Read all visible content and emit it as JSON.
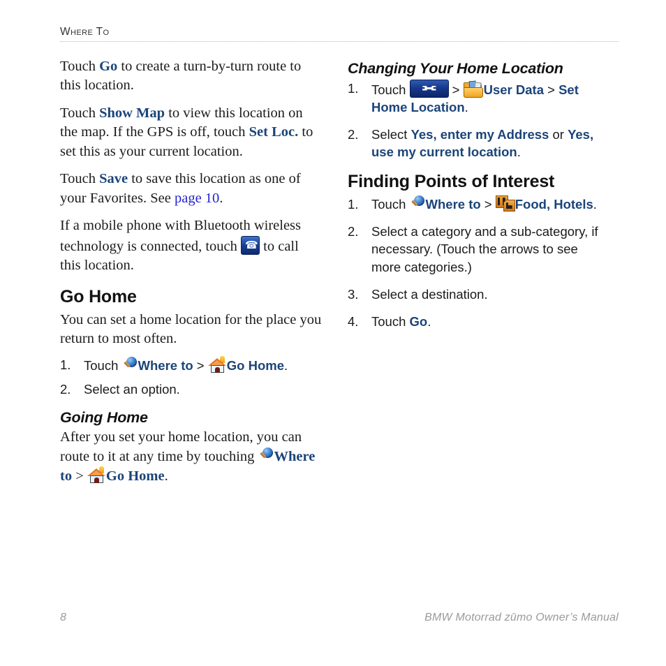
{
  "header": {
    "running_head": "Where To"
  },
  "left_column": {
    "para_go": {
      "pre": "Touch ",
      "kw": "Go",
      "post": " to create a turn-by-turn route to this location."
    },
    "para_showmap": {
      "pre": "Touch ",
      "kw1": "Show Map",
      "mid": " to view this location on the map. If the GPS is off, touch ",
      "kw2": "Set Loc.",
      "post": " to set this as your current location."
    },
    "para_save": {
      "pre": "Touch ",
      "kw": "Save",
      "mid": " to save this location as one of your Favorites. See ",
      "link": "page 10",
      "post": "."
    },
    "para_phone": {
      "pre": "If a mobile phone with Bluetooth wireless technology is connected, touch ",
      "icon": "phone-icon",
      "post": " to call this location."
    },
    "go_home": {
      "heading": "Go Home",
      "intro": "You can set a home location for the place you return to most often.",
      "steps": [
        {
          "num": "1.",
          "pre": "Touch ",
          "icon1": "search-icon",
          "kw1": "Where to",
          "sep": " > ",
          "icon2": "home-icon",
          "kw2": "Go Home",
          "post": "."
        },
        {
          "num": "2.",
          "pre": "Select an option.",
          "kw1": "",
          "sep": "",
          "kw2": "",
          "post": ""
        }
      ]
    },
    "going_home": {
      "heading": "Going Home",
      "pre": "After you set your home location, you can route to it at any time by touching ",
      "icon1": "search-icon",
      "kw1": "Where to",
      "sep": " > ",
      "icon2": "home-icon",
      "kw2": "Go Home",
      "post": "."
    }
  },
  "right_column": {
    "changing_home": {
      "heading": "Changing Your Home Location",
      "steps": [
        {
          "num": "1.",
          "pre": "Touch ",
          "icon1": "tools-icon",
          "sep1": " > ",
          "icon2": "folder-icon",
          "kw1": "User Data",
          "sep2": " > ",
          "kw2": "Set Home Location",
          "post": "."
        },
        {
          "num": "2.",
          "pre": "Select ",
          "kw1": "Yes, enter my Address",
          "sep1": " or ",
          "kw2": "Yes, use my current location",
          "post": "."
        }
      ]
    },
    "finding_poi": {
      "heading": "Finding Points of Interest",
      "steps": [
        {
          "num": "1.",
          "pre": "Touch ",
          "icon1": "search-icon",
          "kw1": "Where to",
          "sep": " > ",
          "icon2": "food-hotels-icon",
          "kw2": "Food, Hotels",
          "post": "."
        },
        {
          "num": "2.",
          "text": "Select a category and a sub-category, if necessary. (Touch the arrows to see more categories.)"
        },
        {
          "num": "3.",
          "text": "Select a destination."
        },
        {
          "num": "4.",
          "pre": "Touch ",
          "kw1": "Go",
          "post": "."
        }
      ]
    }
  },
  "footer": {
    "page_number": "8",
    "book_title": "BMW Motorrad zūmo Owner’s Manual"
  },
  "colors": {
    "keyword_navy": "#1b4479",
    "xref_blue": "#2323cc",
    "body_text": "#1b1b1b",
    "footer_gray": "#9a9a9a",
    "rule_gray": "#b7b7b7"
  }
}
